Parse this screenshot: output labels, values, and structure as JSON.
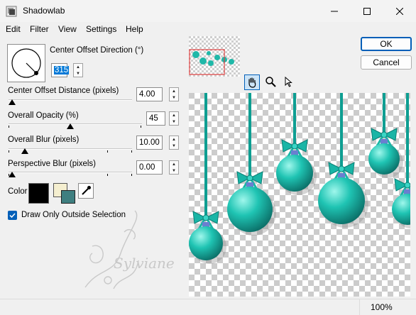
{
  "window": {
    "title": "Shadowlab",
    "controls": [
      "minimize",
      "maximize",
      "close"
    ]
  },
  "menu": [
    "Edit",
    "Filter",
    "View",
    "Settings",
    "Help"
  ],
  "params": {
    "direction": {
      "label": "Center Offset Direction (°)",
      "value": "315"
    },
    "distance": {
      "label": "Center Offset Distance (pixels)",
      "value": "4.00"
    },
    "opacity": {
      "label": "Overall Opacity (%)",
      "value": "45"
    },
    "blur": {
      "label": "Overall Blur (pixels)",
      "value": "10.00"
    },
    "perspective": {
      "label": "Perspective Blur (pixels)",
      "value": "0.00"
    }
  },
  "color": {
    "label": "Color",
    "swatch": "#000000",
    "swatch_back": "#f5efd0",
    "swatch_front": "#3f7f80"
  },
  "checkbox": {
    "label": "Draw Only Outside Selection",
    "checked": true
  },
  "buttons": {
    "ok": "OK",
    "cancel": "Cancel"
  },
  "tools": [
    "hand-icon",
    "zoom-icon",
    "pointer-icon"
  ],
  "watermark": "Sylviane",
  "status": {
    "zoom": "100%"
  },
  "colors": {
    "accent": "#005fb8",
    "ornament": "#1fb8a8",
    "selected_tool": "#cce4f7"
  }
}
